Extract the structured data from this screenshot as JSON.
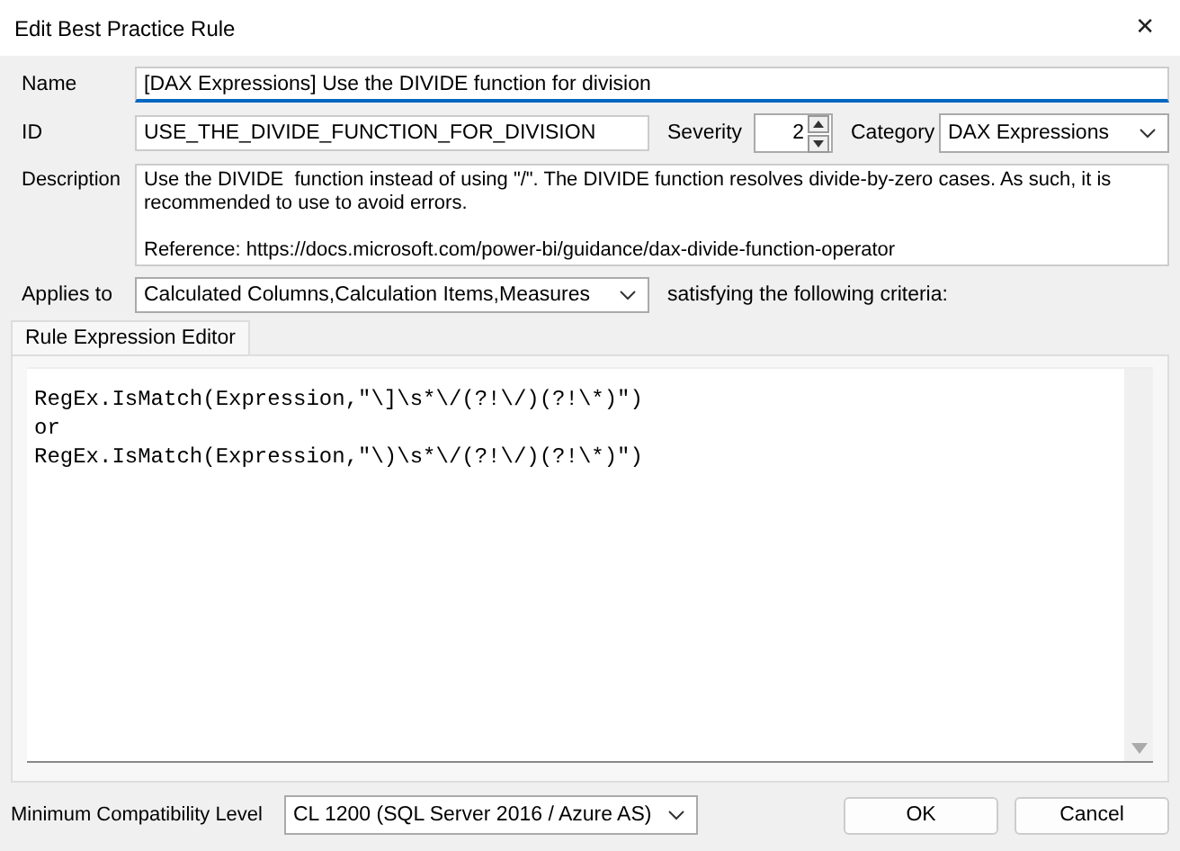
{
  "window": {
    "title": "Edit Best Practice Rule",
    "close": "✕"
  },
  "name": {
    "label": "Name",
    "value": "[DAX Expressions] Use the DIVIDE function for division"
  },
  "id": {
    "label": "ID",
    "value": "USE_THE_DIVIDE_FUNCTION_FOR_DIVISION"
  },
  "severity": {
    "label": "Severity",
    "value": "2"
  },
  "category": {
    "label": "Category",
    "value": "DAX Expressions"
  },
  "description": {
    "label": "Description",
    "value": "Use the DIVIDE  function instead of using \"/\". The DIVIDE function resolves divide-by-zero cases. As such, it is recommended to use to avoid errors.\n\nReference: https://docs.microsoft.com/power-bi/guidance/dax-divide-function-operator"
  },
  "applies_to": {
    "label": "Applies to",
    "value": "Calculated Columns,Calculation Items,Measures",
    "suffix": "satisfying the following criteria:"
  },
  "tabs": [
    {
      "label": "Rule Expression Editor",
      "selected": true
    }
  ],
  "expression_lines": [
    "RegEx.IsMatch(Expression,\"\\]\\s*\\/(?!\\/)(?!\\*)\")",
    "or",
    "RegEx.IsMatch(Expression,\"\\)\\s*\\/(?!\\/)(?!\\*)\")"
  ],
  "compatibility": {
    "label": "Minimum Compatibility Level",
    "value": "CL 1200 (SQL Server 2016 / Azure AS)"
  },
  "buttons": [
    "OK",
    "Cancel"
  ]
}
